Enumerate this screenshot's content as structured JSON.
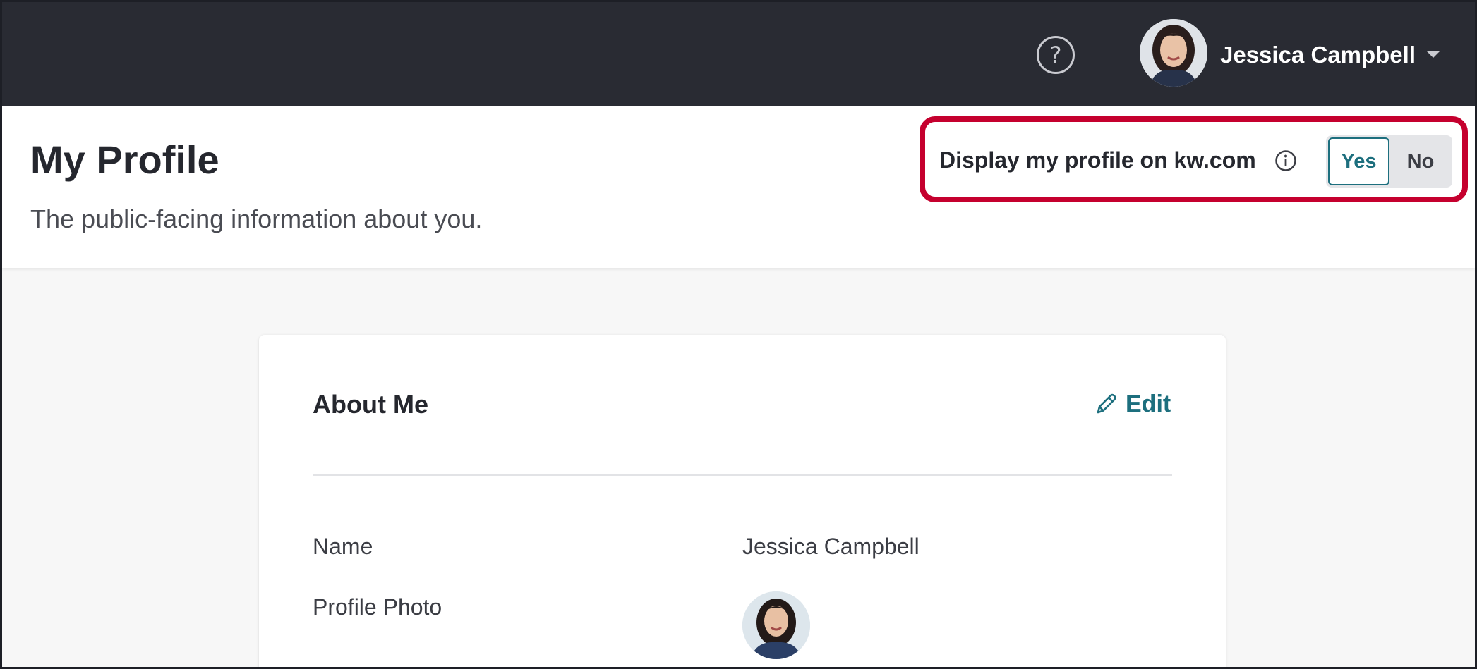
{
  "topbar": {
    "help_symbol": "?",
    "user_name": "Jessica Campbell",
    "bg_color": "#292b33"
  },
  "header": {
    "title": "My Profile",
    "subtitle": "The public-facing information about you.",
    "display_label": "Display my profile on kw.com",
    "toggle": {
      "yes_label": "Yes",
      "no_label": "No",
      "selected": "Yes"
    },
    "highlight_color": "#c5002e"
  },
  "about_card": {
    "title": "About Me",
    "edit_label": "Edit",
    "fields": [
      {
        "label": "Name",
        "value": "Jessica Campbell"
      },
      {
        "label": "Profile Photo",
        "value": ""
      }
    ]
  },
  "accent_color": "#1d6f7e"
}
